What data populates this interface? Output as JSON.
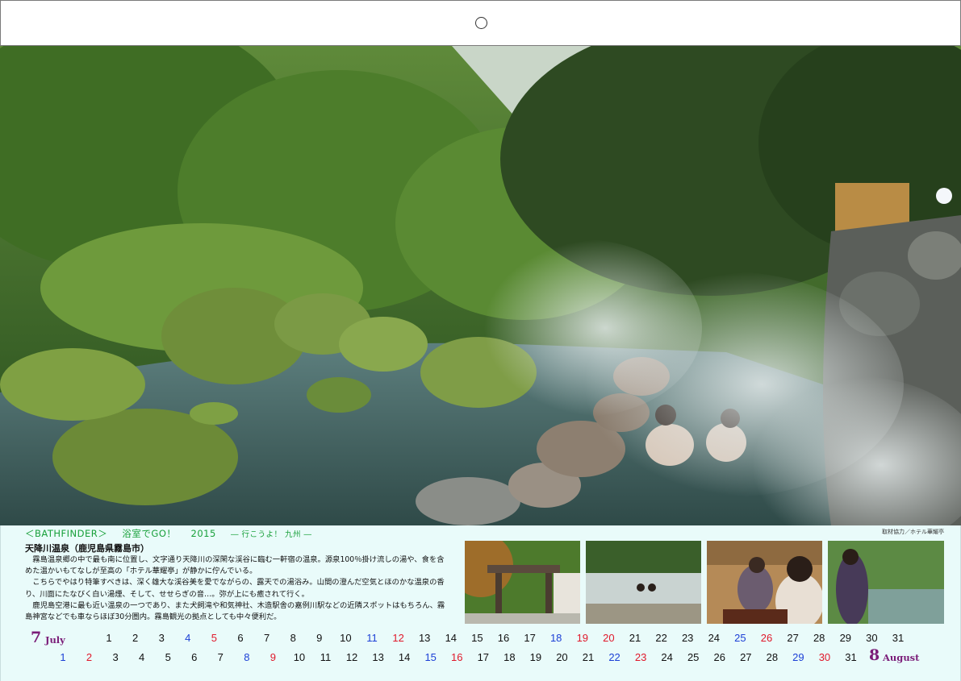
{
  "header": {
    "hole": "○"
  },
  "series": {
    "brand": "＜BATHFINDER＞",
    "title": "浴室でGO！",
    "year": "2015",
    "subtitle": "― 行こうよ！ 九州 ―"
  },
  "credit": "取材協力／ホテル華耀亭",
  "article": {
    "title": "天降川温泉（鹿児島県霧島市）",
    "paragraphs": [
      "霧島温泉郷の中で最も南に位置し、文字通り天降川の深閑な渓谷に臨む一軒宿の温泉。源泉100％掛け流しの湯や、食を含めた温かいもてなしが至高の「ホテル華耀亭」が静かに佇んでいる。",
      "こちらでやはり特筆すべきは、深く雄大な渓谷美を愛でながらの、露天での湯浴み。山間の澄んだ空気とほのかな温泉の香り、川面にたなびく白い湯煙、そして、せせらぎの音…。弥が上にも癒されて行く。",
      "鹿児島空港に最も近い温泉の一つであり、また犬飼滝や和気神社、木造駅舎の嘉例川駅などの近隣スポットはもちろん、霧島神宮などでも車ならほぼ30分圏内。霧島観光の拠点としても中々便利だ。"
    ]
  },
  "calendar": {
    "july": {
      "number": "7",
      "name": "July",
      "days": [
        "1",
        "2",
        "3",
        "4",
        "5",
        "6",
        "7",
        "8",
        "9",
        "10",
        "11",
        "12",
        "13",
        "14",
        "15",
        "16",
        "17",
        "18",
        "19",
        "20",
        "21",
        "22",
        "23",
        "24",
        "25",
        "26",
        "27",
        "28",
        "29",
        "30",
        "31"
      ],
      "saturdays": [
        "4",
        "11",
        "18",
        "25"
      ],
      "sundays": [
        "5",
        "12",
        "19",
        "26"
      ],
      "holidays": [
        "20"
      ]
    },
    "august": {
      "number": "8",
      "name": "August",
      "days": [
        "1",
        "2",
        "3",
        "4",
        "5",
        "6",
        "7",
        "8",
        "9",
        "10",
        "11",
        "12",
        "13",
        "14",
        "15",
        "16",
        "17",
        "18",
        "19",
        "20",
        "21",
        "22",
        "23",
        "24",
        "25",
        "26",
        "27",
        "28",
        "29",
        "30",
        "31"
      ],
      "saturdays": [
        "1",
        "8",
        "15",
        "22",
        "29"
      ],
      "sundays": [
        "2",
        "9",
        "16",
        "23",
        "30"
      ],
      "holidays": []
    }
  },
  "colors": {
    "panel_bg": "#e9fbfa",
    "series_green": "#18a03a",
    "month_purple": "#7a1c78",
    "saturday_blue": "#1b3fd6",
    "sunday_red": "#e0182a"
  }
}
